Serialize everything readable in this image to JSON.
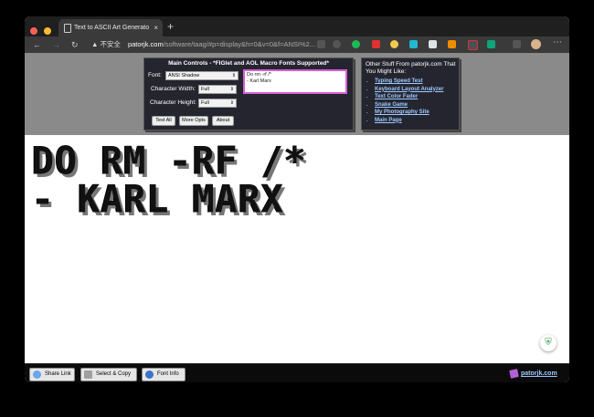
{
  "browser": {
    "tab_title": "Text to ASCII Art Generator (TAAG)",
    "tab_close": "×",
    "new_tab": "+",
    "back": "←",
    "forward": "→",
    "reload": "↻",
    "warning": "▲",
    "insecure_label": "不安全",
    "url_host": "patorjk.com",
    "url_path": "/software/taag/#p=display&h=0&v=0&f=ANSI%2...",
    "more": "⋯"
  },
  "main_controls": {
    "title": "Main Controls - *FIGlet and AOL Macro Fonts Supported*",
    "font_label": "Font:",
    "font_value": "ANSI Shadow",
    "width_label": "Character Width:",
    "width_value": "Full",
    "height_label": "Character Height:",
    "height_value": "Full",
    "buttons": [
      "Test All",
      "More Opts",
      "About"
    ],
    "input_line1": "Do rm -rf /*",
    "input_line2": "- Karl Marx"
  },
  "other_stuff": {
    "title": "Other Stuff From patorjk.com That You Might Like:",
    "links": [
      "Typing Speed Test",
      "Keyboard Layout Analyzer",
      "Text Color Fader",
      "Snake Game",
      "My Photography Site",
      "Main Page"
    ]
  },
  "output": {
    "line1": "DO RM -RF /*",
    "line2": "- KARL MARX"
  },
  "bottom": {
    "share_label": "Share Link",
    "select_label": "Select & Copy",
    "font_info_label": "Font Info",
    "brand": "patorjk.com"
  },
  "colors": {
    "accent_link": "#9ec9ff",
    "textarea_border": "#d65fd6",
    "panel_bg": "#25252f"
  }
}
